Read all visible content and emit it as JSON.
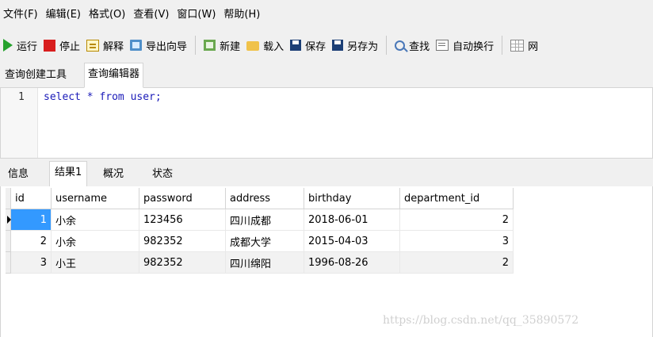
{
  "menu": {
    "items": [
      "文件(F)",
      "编辑(E)",
      "格式(O)",
      "查看(V)",
      "窗口(W)",
      "帮助(H)"
    ]
  },
  "toolbar": {
    "run": "运行",
    "stop": "停止",
    "explain": "解释",
    "export_wizard": "导出向导",
    "new": "新建",
    "load": "载入",
    "save": "保存",
    "save_as": "另存为",
    "find": "查找",
    "word_wrap": "自动换行",
    "grid_partial": "网"
  },
  "query_tabs": [
    "查询创建工具",
    "查询编辑器"
  ],
  "editor": {
    "line_number": "1",
    "sql": "select * from user;"
  },
  "result_tabs": [
    "信息",
    "结果1",
    "概况",
    "状态"
  ],
  "results": {
    "columns": [
      "id",
      "username",
      "password",
      "address",
      "birthday",
      "department_id"
    ],
    "rows": [
      {
        "id": "1",
        "username": "小余",
        "password": "123456",
        "address": "四川成都",
        "birthday": "2018-06-01",
        "department_id": "2"
      },
      {
        "id": "2",
        "username": "小余",
        "password": "982352",
        "address": "成都大学",
        "birthday": "2015-04-03",
        "department_id": "3"
      },
      {
        "id": "3",
        "username": "小王",
        "password": "982352",
        "address": "四川绵阳",
        "birthday": "1996-08-26",
        "department_id": "2"
      }
    ]
  },
  "watermark": "https://blog.csdn.net/qq_35890572"
}
